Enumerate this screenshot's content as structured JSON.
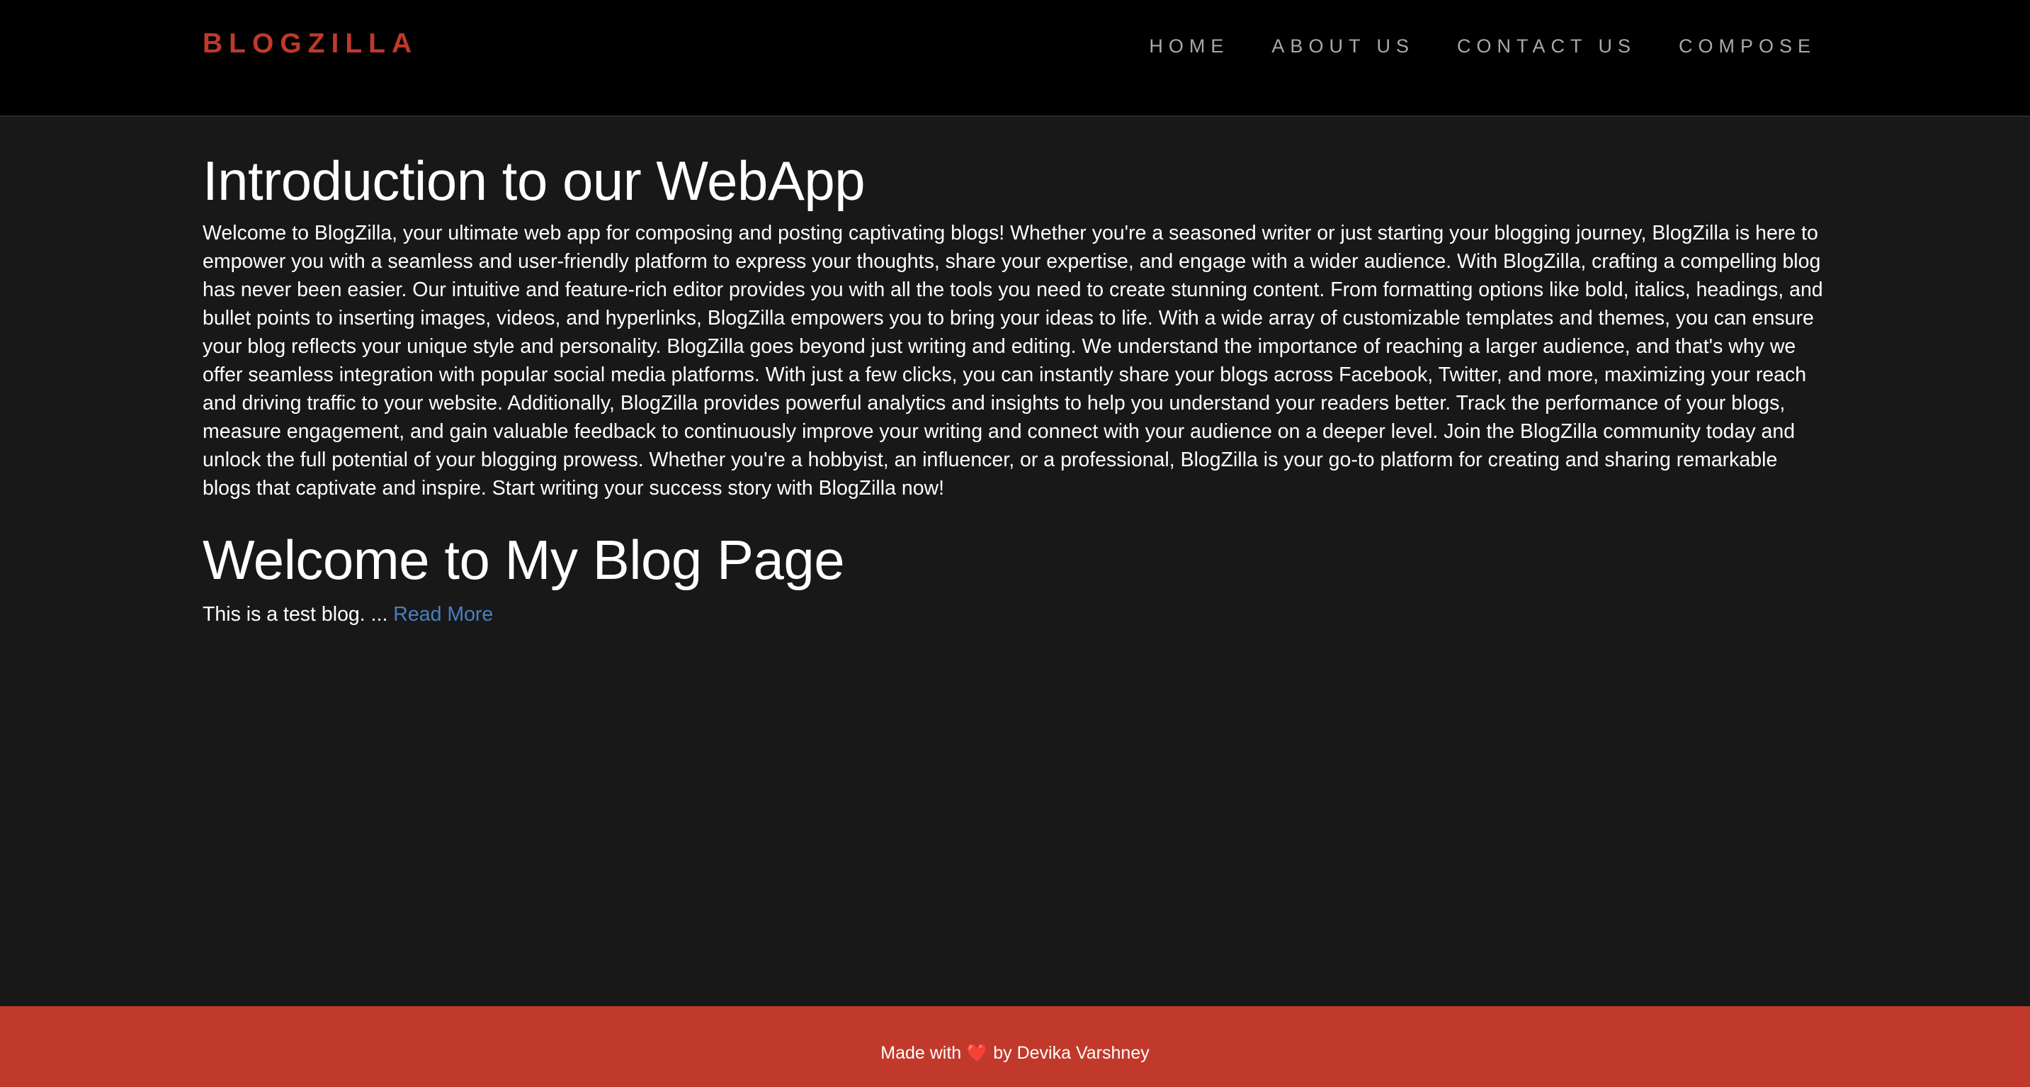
{
  "navbar": {
    "brand": "BLOGZILLA",
    "links": [
      "HOME",
      "ABOUT US",
      "CONTACT US",
      "COMPOSE"
    ]
  },
  "intro": {
    "title": "Introduction to our WebApp",
    "body": "Welcome to BlogZilla, your ultimate web app for composing and posting captivating blogs! Whether you're a seasoned writer or just starting your blogging journey, BlogZilla is here to empower you with a seamless and user-friendly platform to express your thoughts, share your expertise, and engage with a wider audience. With BlogZilla, crafting a compelling blog has never been easier. Our intuitive and feature-rich editor provides you with all the tools you need to create stunning content. From formatting options like bold, italics, headings, and bullet points to inserting images, videos, and hyperlinks, BlogZilla empowers you to bring your ideas to life. With a wide array of customizable templates and themes, you can ensure your blog reflects your unique style and personality. BlogZilla goes beyond just writing and editing. We understand the importance of reaching a larger audience, and that's why we offer seamless integration with popular social media platforms. With just a few clicks, you can instantly share your blogs across Facebook, Twitter, and more, maximizing your reach and driving traffic to your website. Additionally, BlogZilla provides powerful analytics and insights to help you understand your readers better. Track the performance of your blogs, measure engagement, and gain valuable feedback to continuously improve your writing and connect with your audience on a deeper level. Join the BlogZilla community today and unlock the full potential of your blogging prowess. Whether you're a hobbyist, an influencer, or a professional, BlogZilla is your go-to platform for creating and sharing remarkable blogs that captivate and inspire. Start writing your success story with BlogZilla now!"
  },
  "posts": [
    {
      "title": "Welcome to My Blog Page",
      "excerpt": "This is a test blog. ...",
      "read_more": "Read More"
    }
  ],
  "footer": {
    "made_with": "Made with",
    "heart": "❤️",
    "by": "by Devika Varshney"
  },
  "colors": {
    "brand": "#c0392b",
    "navbar_bg": "#000000",
    "page_bg": "#181818",
    "nav_link": "#a9a9a9",
    "link": "#4a7fc1",
    "footer_bg": "#c0392b"
  }
}
